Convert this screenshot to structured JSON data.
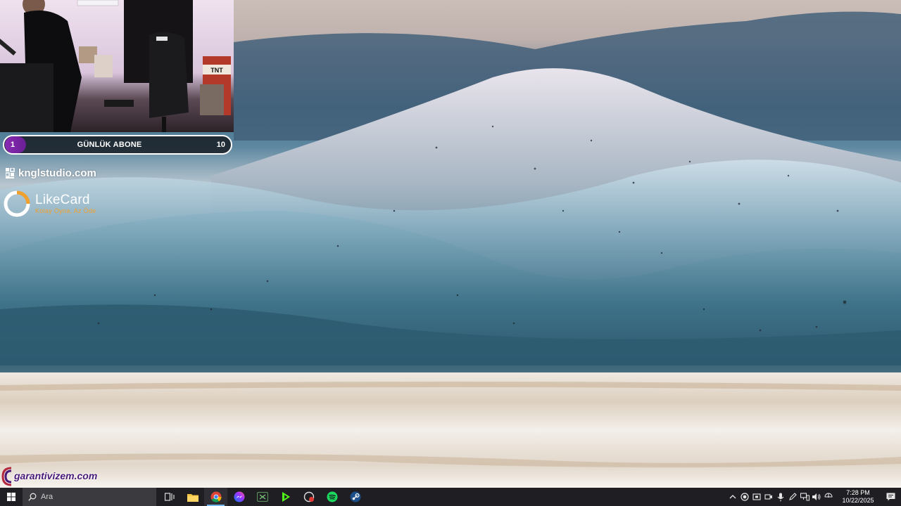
{
  "overlay": {
    "subscriber_goal": {
      "current": "1",
      "label": "GÜNLÜK ABONE",
      "target": "10"
    },
    "sponsor_kngl": "knglstudio.com",
    "sponsor_likecard": {
      "title": "LikeCard",
      "tagline": "Kolay Oyna, Az Öde"
    },
    "sponsor_garanti": "garantivizem.com",
    "webcam_sign": "TNT"
  },
  "taskbar": {
    "search_placeholder": "Ara",
    "pinned": [
      {
        "name": "task-view-icon"
      },
      {
        "name": "file-explorer-icon"
      },
      {
        "name": "chrome-icon",
        "active": true
      },
      {
        "name": "messenger-icon"
      },
      {
        "name": "xbox-icon"
      },
      {
        "name": "kick-studio-icon"
      },
      {
        "name": "recorder-icon"
      },
      {
        "name": "spotify-icon"
      },
      {
        "name": "steam-icon"
      }
    ],
    "clock_time": "7:28 PM",
    "clock_date": "10/22/2025"
  },
  "colors": {
    "taskbar_bg": "#1f1f23",
    "goal_accent": "#8a2bb5",
    "likecard_accent": "#f0a02c",
    "chrome_active_underline": "#76b9ed"
  }
}
